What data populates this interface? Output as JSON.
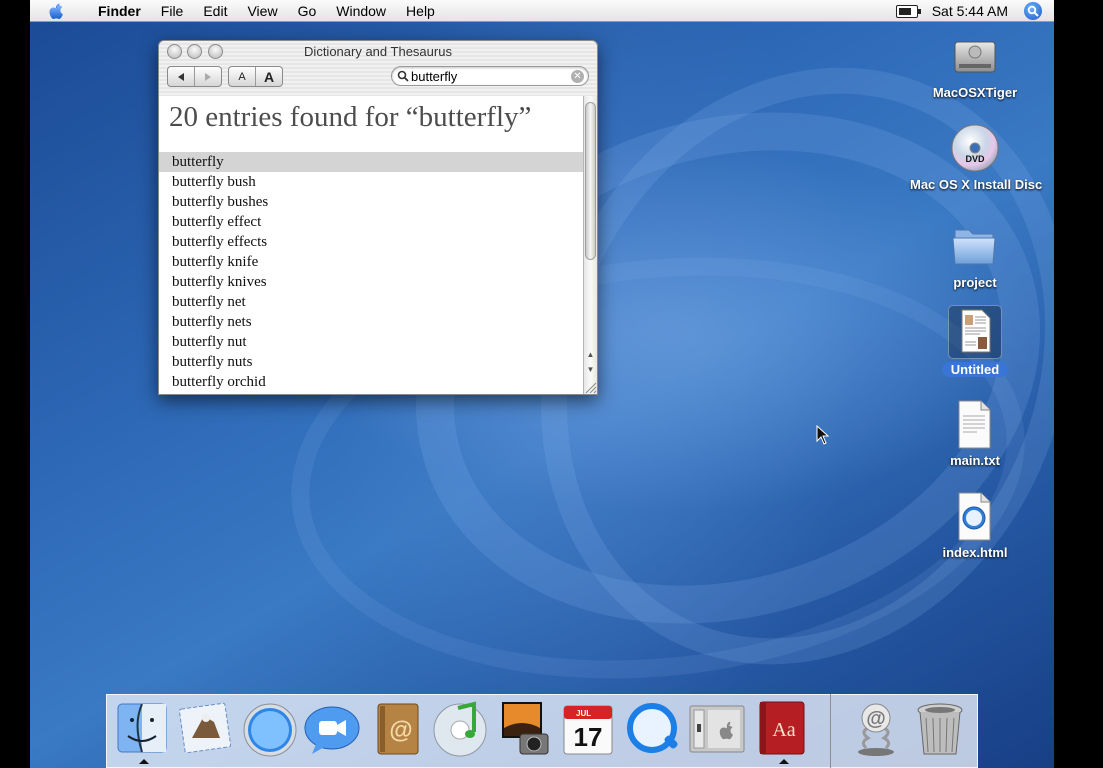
{
  "menubar": {
    "app_name": "Finder",
    "menus": [
      "File",
      "Edit",
      "View",
      "Go",
      "Window",
      "Help"
    ],
    "clock": "Sat 5:44 AM"
  },
  "window": {
    "title": "Dictionary and Thesaurus",
    "font_small_label": "A",
    "font_large_label": "A",
    "search_value": "butterfly",
    "heading": "20 entries found for “butterfly”",
    "entries": [
      "butterfly",
      "butterfly bush",
      "butterfly bushes",
      "butterfly effect",
      "butterfly effects",
      "butterfly knife",
      "butterfly knives",
      "butterfly net",
      "butterfly nets",
      "butterfly nut",
      "butterfly nuts",
      "butterfly orchid"
    ],
    "selected_index": 0
  },
  "desktop_icons": [
    {
      "label": "MacOSXTiger",
      "icon": "hard-drive-icon"
    },
    {
      "label": "Mac OS X Install Disc",
      "icon": "dvd-icon"
    },
    {
      "label": "project",
      "icon": "folder-icon"
    },
    {
      "label": "Untitled",
      "icon": "document-icon",
      "selected": true
    },
    {
      "label": "main.txt",
      "icon": "text-file-icon"
    },
    {
      "label": "index.html",
      "icon": "html-file-icon"
    }
  ],
  "dock": {
    "apps": [
      "finder-icon",
      "mail-icon",
      "safari-icon",
      "ichat-icon",
      "address-book-icon",
      "itunes-icon",
      "iphoto-icon",
      "ical-icon",
      "quicktime-icon",
      "system-preferences-icon",
      "dictionary-icon"
    ],
    "ical_month": "JUL",
    "ical_day": "17",
    "dictionary_label": "Aa",
    "others": [
      "mail-downloads-stack-icon",
      "trash-icon"
    ]
  },
  "colors": {
    "selection": "#3875d7",
    "list_selection": "#d4d4d4"
  }
}
